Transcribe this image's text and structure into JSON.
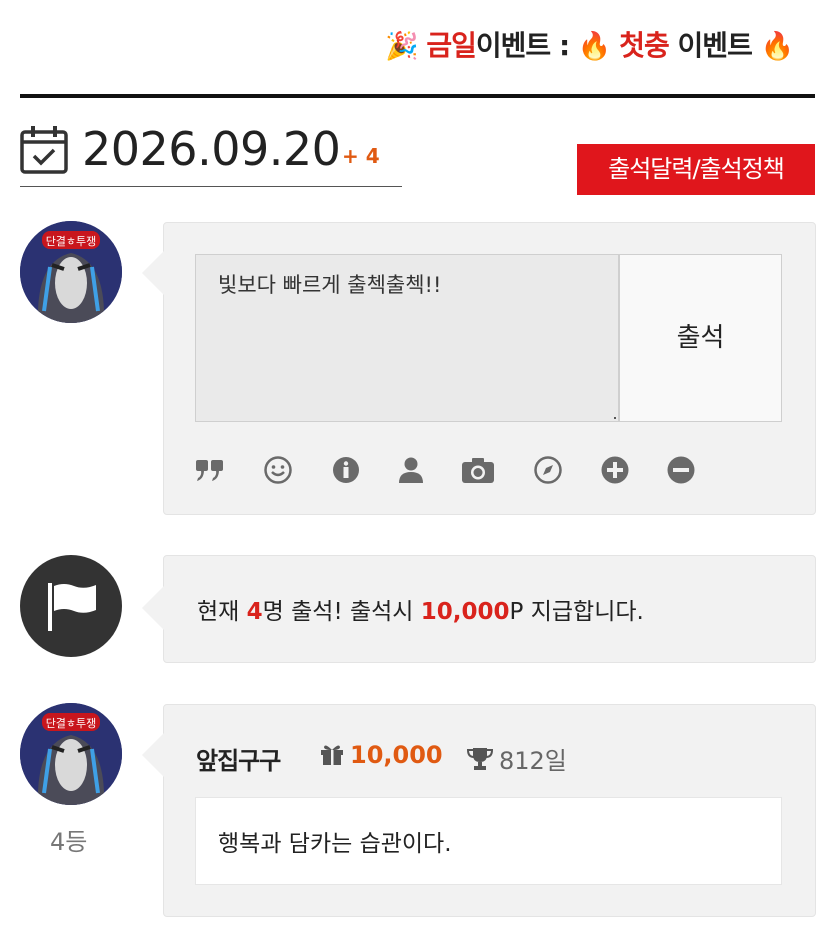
{
  "ticker": {
    "part1_emoji": "🎉",
    "part1_red": "금일",
    "part1_dark": "이벤트",
    "separator": ":",
    "part2_emoji": "🔥",
    "part2_red": "첫충",
    "part2_dark": "이벤트",
    "part3_emoji": "🔥"
  },
  "header": {
    "date": "2026.09.20",
    "date_plus": "+ 4",
    "policy_button": "출석달력/출석정책"
  },
  "composer": {
    "message_value": "빛보다 빠르게 출첵출첵!!",
    "submit_label": "출석",
    "tools": [
      "quote-icon",
      "smile-icon",
      "info-icon",
      "user-icon",
      "camera-icon",
      "compass-icon",
      "plus-circle-icon",
      "minus-circle-icon"
    ]
  },
  "status": {
    "prefix": "현재 ",
    "count": "4",
    "mid": "명 출석! 출석시 ",
    "points": "10,000",
    "suffix": "P 지급합니다."
  },
  "entry": {
    "rank": "4등",
    "username": "앞집구구",
    "points": "10,000",
    "days": "812일",
    "message": "행복과 담카는 습관이다."
  },
  "avatar_badge": "단결ㅎ투쟁",
  "colors": {
    "accent_red": "#e0161c",
    "points_orange": "#e05a12",
    "card_bg": "#f2f2f2"
  }
}
